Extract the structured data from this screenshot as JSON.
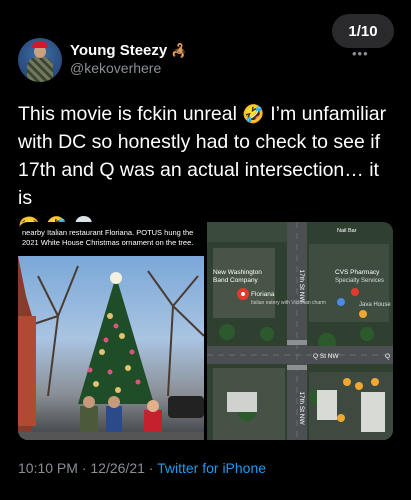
{
  "header": {
    "page_counter": "1/10",
    "more_dots": "•••"
  },
  "author": {
    "display_name": "Young Steezy",
    "name_emoji": "🦂",
    "handle": "@kekoverhere"
  },
  "tweet": {
    "text_line1": "This movie is fckin unreal",
    "emoji1": "🤣",
    "text_line1b": "I’m unfamiliar",
    "text_line2": "with DC so honestly had to check to see if",
    "text_line3": "17th and Q was an actual intersection… it is",
    "emoji_row": "😂 🤣 💀"
  },
  "media": {
    "left": {
      "caption": "nearby Italian restaurant Floriana. POTUS hung the 2021 White House Christmas ornament on the tree."
    },
    "right": {
      "labels": {
        "new_washington": "New Washington",
        "band_company": "Band Company",
        "cvs": "CVS Pharmacy",
        "specialty": "Specialty Services",
        "java_house": "Java House",
        "floriana": "Floriana",
        "floriana_sub": "Italian eatery with Victorian charm",
        "street_17th_top": "17th St NW",
        "street_17th_bottom": "17th St NW",
        "q_st": "Q St NW",
        "q_letter": "Q",
        "nail_bar": "Nail Bar"
      }
    }
  },
  "meta": {
    "time": "10:10 PM",
    "separator": "·",
    "date": "12/26/21",
    "source": "Twitter for iPhone"
  }
}
